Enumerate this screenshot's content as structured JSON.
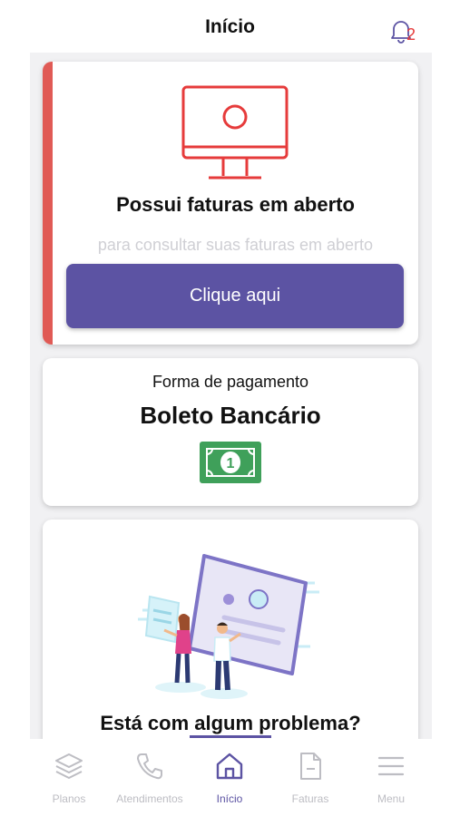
{
  "header": {
    "title": "Início",
    "notification_count": "2"
  },
  "invoice_card": {
    "heading": "Possui faturas em aberto",
    "subtitle": "para consultar suas faturas em aberto",
    "button_label": "Clique aqui"
  },
  "payment_card": {
    "label": "Forma de pagamento",
    "value": "Boleto Bancário"
  },
  "help_card": {
    "question": "Está com algum problema?"
  },
  "tabbar": {
    "items": [
      {
        "label": "Planos",
        "icon": "layers-icon"
      },
      {
        "label": "Atendimentos",
        "icon": "phone-icon"
      },
      {
        "label": "Início",
        "icon": "home-icon"
      },
      {
        "label": "Faturas",
        "icon": "document-icon"
      },
      {
        "label": "Menu",
        "icon": "menu-icon"
      }
    ],
    "active_index": 2
  },
  "colors": {
    "accent": "#5c53a3",
    "alert": "#e05a55",
    "money_green": "#3fa05a"
  }
}
